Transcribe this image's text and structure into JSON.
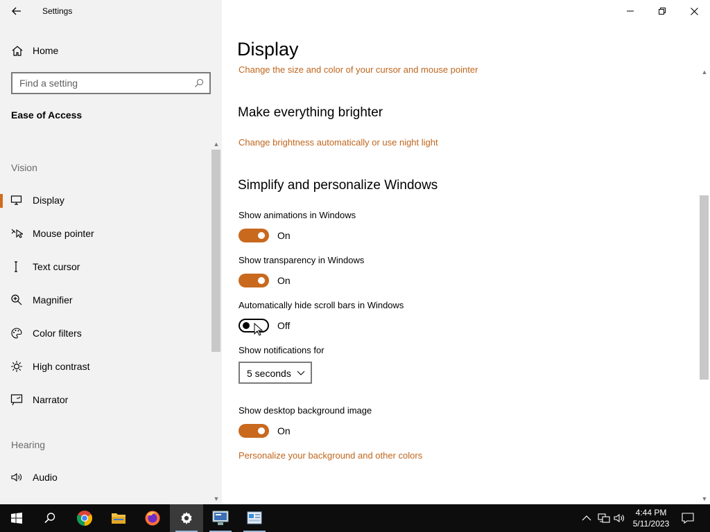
{
  "window": {
    "title": "Settings"
  },
  "sidebar": {
    "home_label": "Home",
    "search_placeholder": "Find a setting",
    "section_heading": "Ease of Access",
    "groups": [
      {
        "label": "Vision"
      },
      {
        "label": "Hearing"
      }
    ],
    "items": [
      {
        "label": "Display",
        "icon": "monitor-icon",
        "selected": true
      },
      {
        "label": "Mouse pointer",
        "icon": "mouse-pointer-icon"
      },
      {
        "label": "Text cursor",
        "icon": "text-cursor-icon"
      },
      {
        "label": "Magnifier",
        "icon": "magnifier-icon"
      },
      {
        "label": "Color filters",
        "icon": "palette-icon"
      },
      {
        "label": "High contrast",
        "icon": "contrast-icon"
      },
      {
        "label": "Narrator",
        "icon": "narrator-icon"
      },
      {
        "label": "Audio",
        "icon": "speaker-icon"
      }
    ]
  },
  "main": {
    "page_title": "Display",
    "cursor_link": "Change the size and color of your cursor and mouse pointer",
    "brighter": {
      "title": "Make everything brighter",
      "link": "Change brightness automatically or use night light"
    },
    "simplify": {
      "title": "Simplify and personalize Windows",
      "settings": [
        {
          "label": "Show animations in Windows",
          "state": "On",
          "on": true
        },
        {
          "label": "Show transparency in Windows",
          "state": "On",
          "on": true
        },
        {
          "label": "Automatically hide scroll bars in Windows",
          "state": "Off",
          "on": false
        }
      ],
      "notifications_label": "Show notifications for",
      "notifications_value": "5 seconds",
      "background_label": "Show desktop background image",
      "background_state": "On",
      "personalize_link": "Personalize your background and other colors"
    }
  },
  "colors": {
    "accent": "#c9691e",
    "link": "#c0651c",
    "sidebar_bg": "#f2f2f2",
    "taskbar_bg": "#0d0d0d"
  },
  "taskbar": {
    "apps": [
      "start-icon",
      "search-icon",
      "chrome-icon",
      "file-explorer-icon",
      "firefox-icon",
      "settings-icon",
      "remote-desktop-icon",
      "control-panel-icon"
    ],
    "time": "4:44 PM",
    "date": "5/11/2023"
  }
}
